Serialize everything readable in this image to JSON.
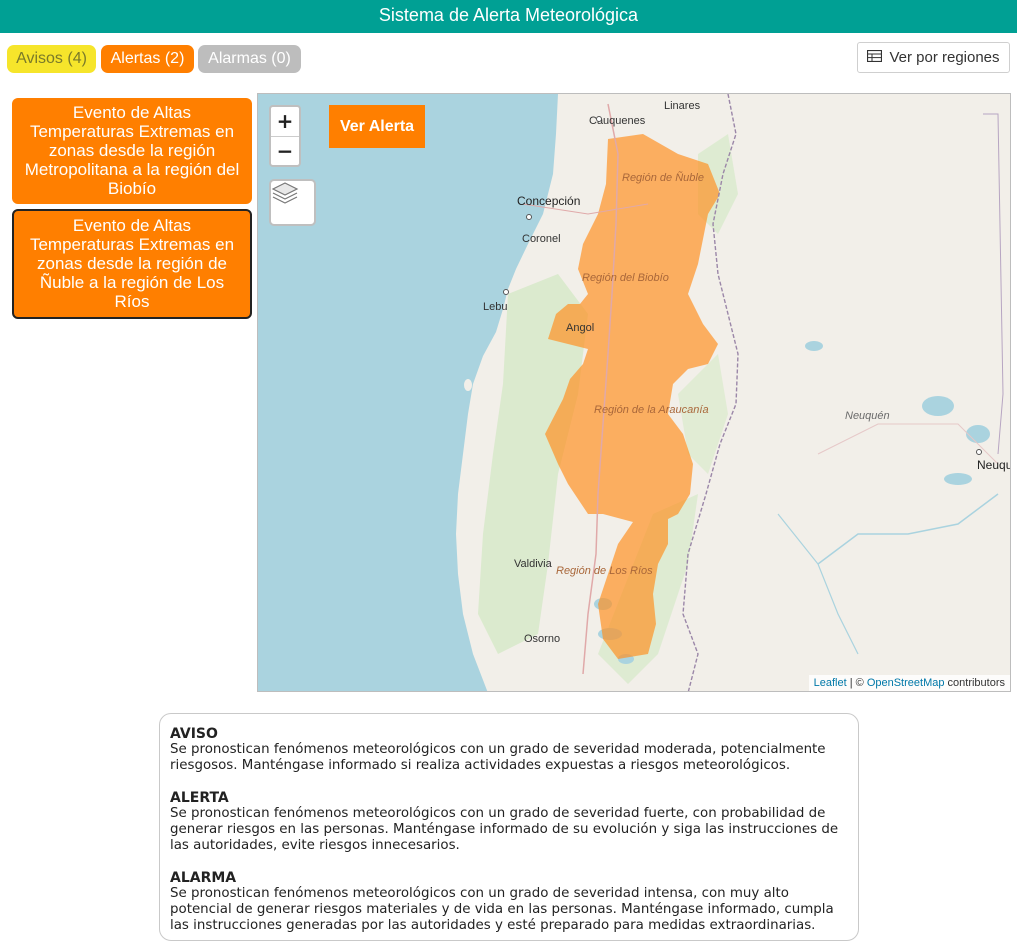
{
  "header": {
    "title": "Sistema de Alerta Meteorológica"
  },
  "filters": [
    {
      "label": "Avisos (4)",
      "color": "#f6e52b"
    },
    {
      "label": "Alertas (2)",
      "color": "#ff7f00"
    },
    {
      "label": "Alarmas (0)",
      "color": "#bdbdbd"
    }
  ],
  "view_regions": {
    "label": "Ver por regiones",
    "icon": "table-icon"
  },
  "events": [
    {
      "title": "Evento de Altas Temperaturas Extremas en zonas desde la región Metropolitana a la región del Biobío"
    },
    {
      "title": "Evento de Altas Temperaturas Extremas en zonas desde la región de Ñuble a la región de Los Ríos"
    }
  ],
  "map": {
    "zoom_in": "+",
    "zoom_out": "−",
    "layers_icon": "layers-icon",
    "ver_alerta": "Ver Alerta",
    "alert_color": "#ff7f00",
    "attribution": {
      "leaflet": "Leaflet",
      "sep": " | © ",
      "osm": "OpenStreetMap",
      "suffix": " contributors"
    },
    "cities": [
      "Linares",
      "Cauquenes",
      "Concepción",
      "Coronel",
      "Lebu",
      "Angol",
      "Valdivia",
      "Osorno",
      "Neuquén"
    ],
    "regions": [
      "Región de Ñuble",
      "Región del Biobío",
      "Región de la Araucanía",
      "Región de Los Ríos"
    ],
    "provinces": [
      "Neuquén"
    ]
  },
  "legend": [
    {
      "title": "AVISO",
      "text": "Se pronostican fenómenos meteorológicos con un grado de severidad moderada, potencialmente riesgosos. Manténgase informado si realiza actividades expuestas a riesgos meteorológicos."
    },
    {
      "title": "ALERTA",
      "text": "Se pronostican fenómenos meteorológicos con un grado de severidad fuerte, con probabilidad de generar riesgos en las personas. Manténgase informado de su evolución y siga las instrucciones de las autoridades, evite riesgos innecesarios."
    },
    {
      "title": "ALARMA",
      "text": "Se pronostican fenómenos meteorológicos con un grado de severidad intensa, con muy alto potencial de generar riesgos materiales y de vida en las personas. Manténgase informado, cumpla las instrucciones generadas por las autoridades y esté preparado para medidas extraordinarias."
    }
  ]
}
